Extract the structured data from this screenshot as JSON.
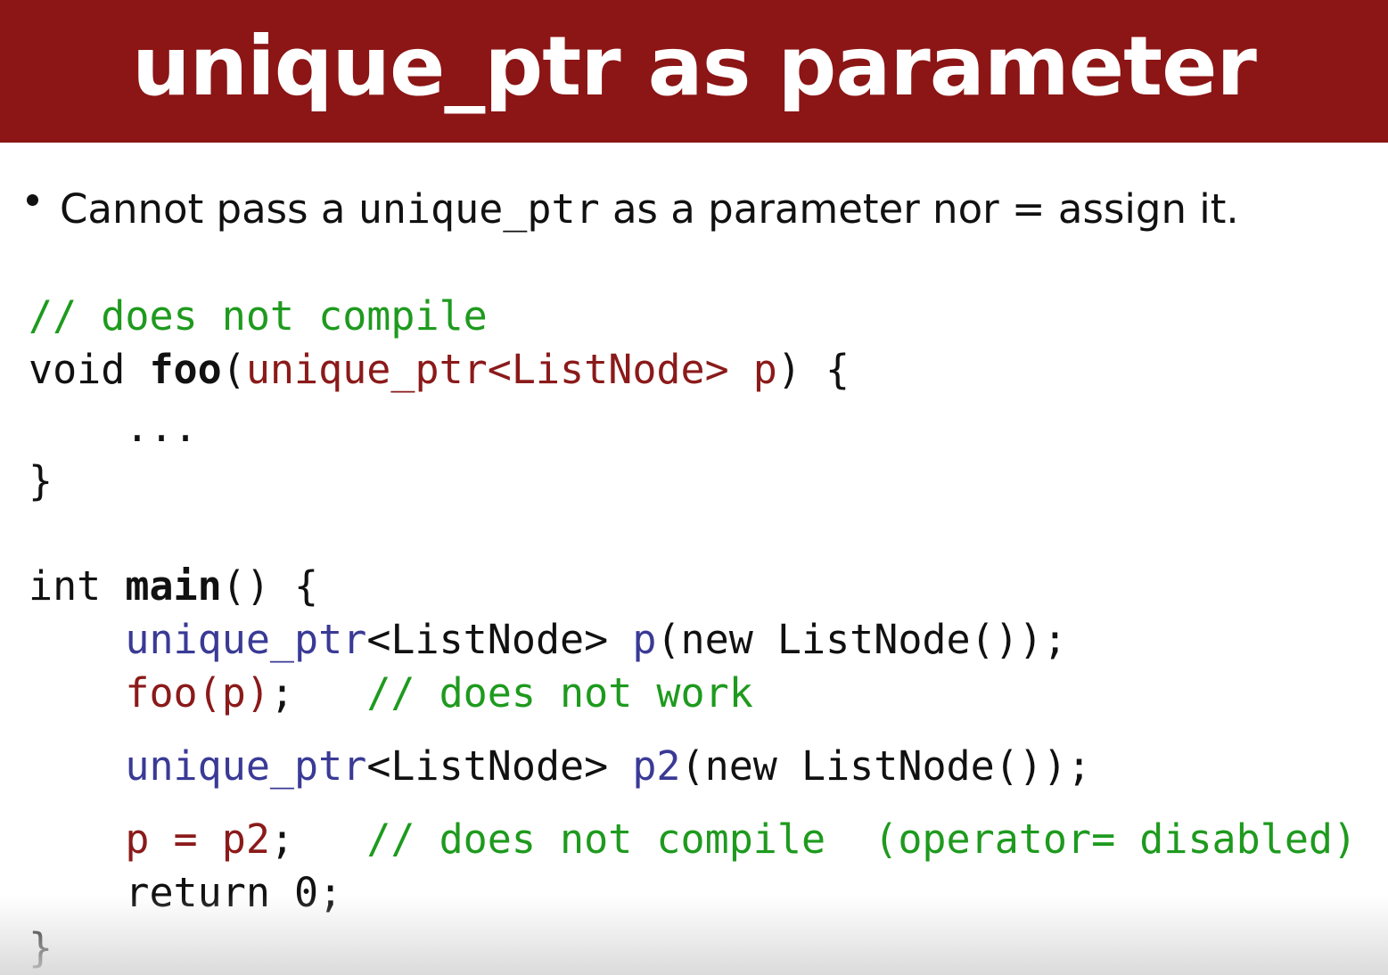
{
  "slide": {
    "title": "unique_ptr as parameter",
    "bullet": {
      "pre": "Cannot pass a ",
      "code": "unique_ptr",
      "post": " as a parameter nor = assign it."
    }
  },
  "code": {
    "l1": "// does not compile",
    "l2_void": "void ",
    "l2_foo": "foo",
    "l2_open": "(",
    "l2_param": "unique_ptr<ListNode> p",
    "l2_close": ") {",
    "l3": "    ...",
    "l4": "}",
    "l6_int": "int ",
    "l6_main": "main",
    "l6_rest": "() {",
    "l7_indent": "    ",
    "l7_type": "unique_ptr",
    "l7_tmpl": "<ListNode> ",
    "l7_var": "p",
    "l7_rest": "(new ListNode());",
    "l8_indent": "    ",
    "l8_call": "foo(p)",
    "l8_semi": ";   ",
    "l8_comment": "// does not work",
    "l9_indent": "    ",
    "l9_type": "unique_ptr",
    "l9_tmpl": "<ListNode> ",
    "l9_var": "p2",
    "l9_rest": "(new ListNode());",
    "l10_indent": "    ",
    "l10_assign": "p = p2",
    "l10_semi": ";   ",
    "l10_comment": "// does not compile  (operator= disabled)",
    "l11": "    return 0;",
    "l12": "}"
  },
  "colors": {
    "title_bar": "#8c1515",
    "comment": "#1e9a1e",
    "param_red": "#8b1a1a",
    "type_blue": "#3a3a96"
  }
}
